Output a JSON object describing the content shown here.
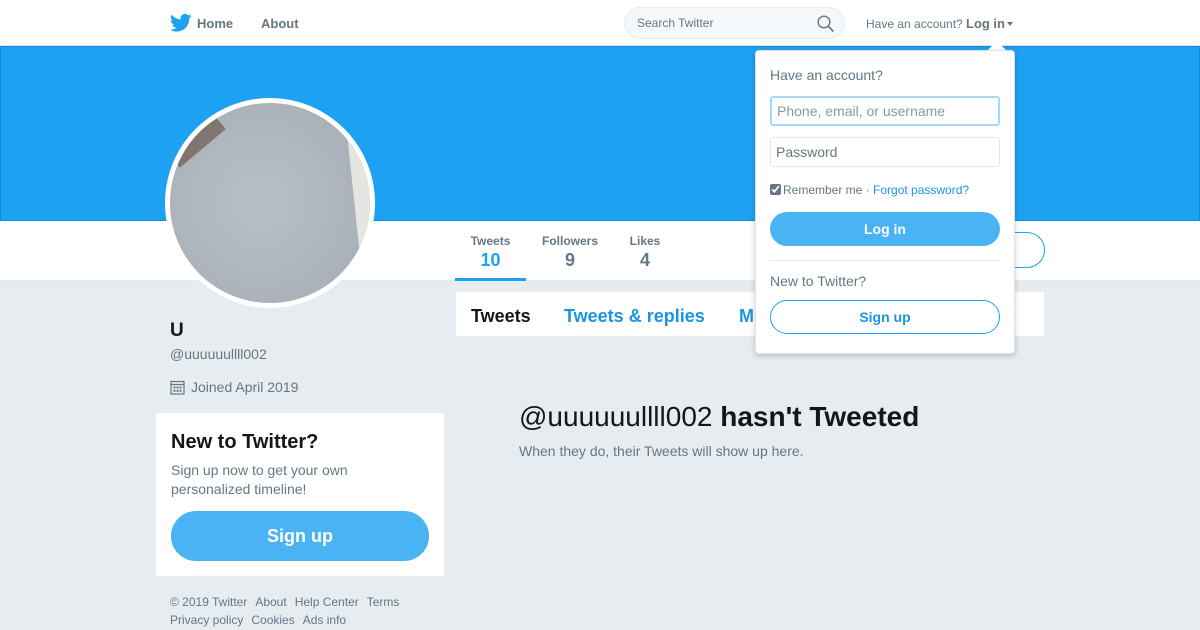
{
  "nav": {
    "home": "Home",
    "about": "About",
    "search_placeholder": "Search Twitter",
    "have_account": "Have an account?",
    "login": "Log in"
  },
  "profile_nav": {
    "stats": [
      {
        "label": "Tweets",
        "value": "10"
      },
      {
        "label": "Followers",
        "value": "9"
      },
      {
        "label": "Likes",
        "value": "4"
      }
    ]
  },
  "profile": {
    "name": "U",
    "handle": "@uuuuuullll002",
    "joined": "Joined April 2019"
  },
  "signup_card": {
    "title": "New to Twitter?",
    "text": "Sign up now to get your own personalized timeline!",
    "button": "Sign up"
  },
  "footer": {
    "links": [
      "© 2019 Twitter",
      "About",
      "Help Center",
      "Terms",
      "Privacy policy",
      "Cookies",
      "Ads info"
    ]
  },
  "timeline": {
    "tabs": [
      "Tweets",
      "Tweets & replies",
      "M"
    ],
    "empty_handle": "@uuuuuullll002",
    "empty_title_rest": "hasn't Tweeted",
    "empty_sub": "When they do, their Tweets will show up here."
  },
  "dropdown": {
    "heading": "Have an account?",
    "username_placeholder": "Phone, email, or username",
    "password_placeholder": "Password",
    "remember": "Remember me",
    "separator": " · ",
    "forgot": "Forgot password?",
    "login_button": "Log in",
    "new_to_twitter": "New to Twitter?",
    "signup_button": "Sign up"
  },
  "colors": {
    "brand": "#1da1f2",
    "button": "#4ab3f4",
    "link": "#1b95e0",
    "background": "#e6ecf0"
  }
}
